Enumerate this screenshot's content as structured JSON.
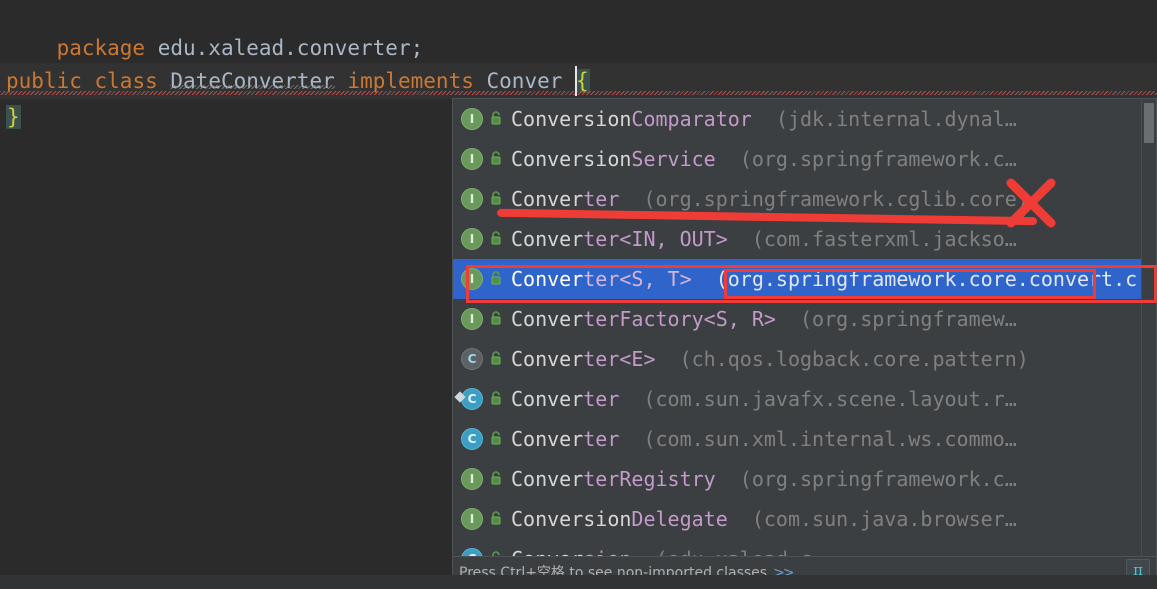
{
  "editor": {
    "lines": [
      {
        "id": "package",
        "keyword": "package",
        "text": " edu.xalead.converter;"
      },
      {
        "id": "class",
        "modifier": "public",
        "keyword2": "class",
        "class_name": "DateConverter",
        "implements_keyword": "implements",
        "typed_text": "Conver",
        "open_brace": "{"
      },
      {
        "id": "close",
        "close_brace": "}"
      }
    ]
  },
  "popup": {
    "status_text": "Press Ctrl+空格 to see non-imported classes",
    "status_link": ">>",
    "pi_badge": "π",
    "items": [
      {
        "icon": "interface-icon",
        "icon_class": "icon-interface",
        "icon_letter": "I",
        "match": "Conversion",
        "name": "Comparator",
        "package": "(jdk.internal.dynal…"
      },
      {
        "icon": "interface-icon",
        "icon_class": "icon-interface",
        "icon_letter": "I",
        "match": "Conversion",
        "name": "Service",
        "package": "(org.springframework.c…"
      },
      {
        "icon": "interface-icon",
        "icon_class": "icon-interface",
        "icon_letter": "I",
        "match": "Conver",
        "name": "ter",
        "package": "(org.springframework.cglib.core)"
      },
      {
        "icon": "interface-icon",
        "icon_class": "icon-interface",
        "icon_letter": "I",
        "match": "Conver",
        "name": "ter<IN, OUT>",
        "package": "(com.fasterxml.jackso…"
      },
      {
        "icon": "interface-icon",
        "icon_class": "icon-interface",
        "icon_letter": "I",
        "match": "Conver",
        "name": "ter<S, T>",
        "package": "(org.springframework.core.convert.c",
        "selected": true
      },
      {
        "icon": "interface-icon",
        "icon_class": "icon-interface",
        "icon_letter": "I",
        "match": "Conver",
        "name": "terFactory<S, R>",
        "package": "(org.springframew…"
      },
      {
        "icon": "class-icon",
        "icon_class": "icon-class-gray",
        "icon_letter": "C",
        "match": "Conver",
        "name": "ter<E>",
        "package": "(ch.qos.logback.core.pattern)"
      },
      {
        "icon": "class-icon-fx",
        "icon_class": "icon-class-fx",
        "icon_letter": "C",
        "match": "Conver",
        "name": "ter",
        "package": "(com.sun.javafx.scene.layout.r…"
      },
      {
        "icon": "class-icon",
        "icon_class": "icon-class",
        "icon_letter": "C",
        "match": "Conver",
        "name": "ter",
        "package": "(com.sun.xml.internal.ws.commo…"
      },
      {
        "icon": "interface-icon",
        "icon_class": "icon-interface",
        "icon_letter": "I",
        "match": "Conver",
        "name": "terRegistry",
        "package": "(org.springframework.c…"
      },
      {
        "icon": "interface-icon",
        "icon_class": "icon-interface",
        "icon_letter": "I",
        "match": "Conversion",
        "name": "Delegate",
        "package": "(com.sun.java.browser…"
      },
      {
        "icon": "class-icon",
        "icon_class": "icon-class",
        "icon_letter": "C",
        "match": "Conver",
        "name": "sion",
        "package": "(edu.xalead.c…"
      }
    ]
  },
  "annotations": {
    "underline_color": "#f03c36",
    "x_mark_color": "#f03c36",
    "rect_color": "#f03c36"
  },
  "colors": {
    "editor_bg": "#2b2b2b",
    "popup_bg": "#3c3f41",
    "selection_bg": "#2f65ca",
    "keyword": "#cc7832",
    "identifier": "#a9b7c6",
    "brace": "#cfcf3f"
  }
}
